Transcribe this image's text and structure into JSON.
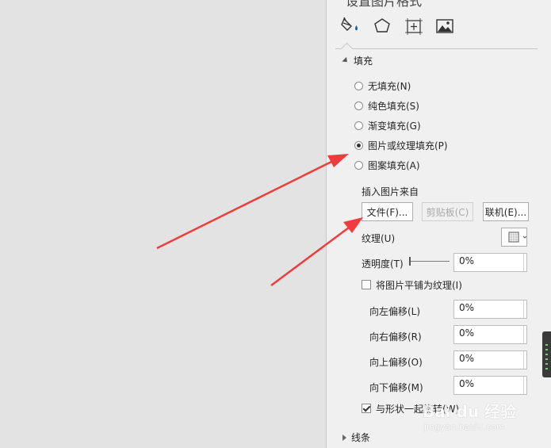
{
  "panel": {
    "title": "设置图片格式",
    "tabs": [
      {
        "icon": "fill-bucket-icon"
      },
      {
        "icon": "pentagon-effects-icon"
      },
      {
        "icon": "size-properties-icon"
      },
      {
        "icon": "picture-icon"
      }
    ],
    "fill_section": {
      "title": "填充",
      "options": [
        {
          "label": "无填充(N)",
          "selected": false
        },
        {
          "label": "纯色填充(S)",
          "selected": false
        },
        {
          "label": "渐变填充(G)",
          "selected": false
        },
        {
          "label": "图片或纹理填充(P)",
          "selected": true
        },
        {
          "label": "图案填充(A)",
          "selected": false
        }
      ],
      "insert_from_label": "插入图片来自",
      "buttons": {
        "file": "文件(F)...",
        "clipboard": "剪贴板(C)",
        "online": "联机(E)..."
      },
      "texture_label": "纹理(U)",
      "transparency_label": "透明度(T)",
      "transparency_value": "0%",
      "tile_label": "将图片平铺为纹理(I)",
      "tile_checked": false,
      "offsets": [
        {
          "label": "向左偏移(L)",
          "value": "0%"
        },
        {
          "label": "向右偏移(R)",
          "value": "0%"
        },
        {
          "label": "向上偏移(O)",
          "value": "0%"
        },
        {
          "label": "向下偏移(M)",
          "value": "0%"
        }
      ],
      "rotate_label": "与形状一起旋转(W)",
      "rotate_checked": true
    },
    "line_section": {
      "title": "线条"
    }
  },
  "watermark": {
    "text": "Bai du 经验",
    "sub": "jingyan.baidu.com"
  },
  "colors": {
    "arrow": "#f03c3c",
    "panel_bg": "#f0f0f0",
    "background": "#e3e3e3"
  }
}
